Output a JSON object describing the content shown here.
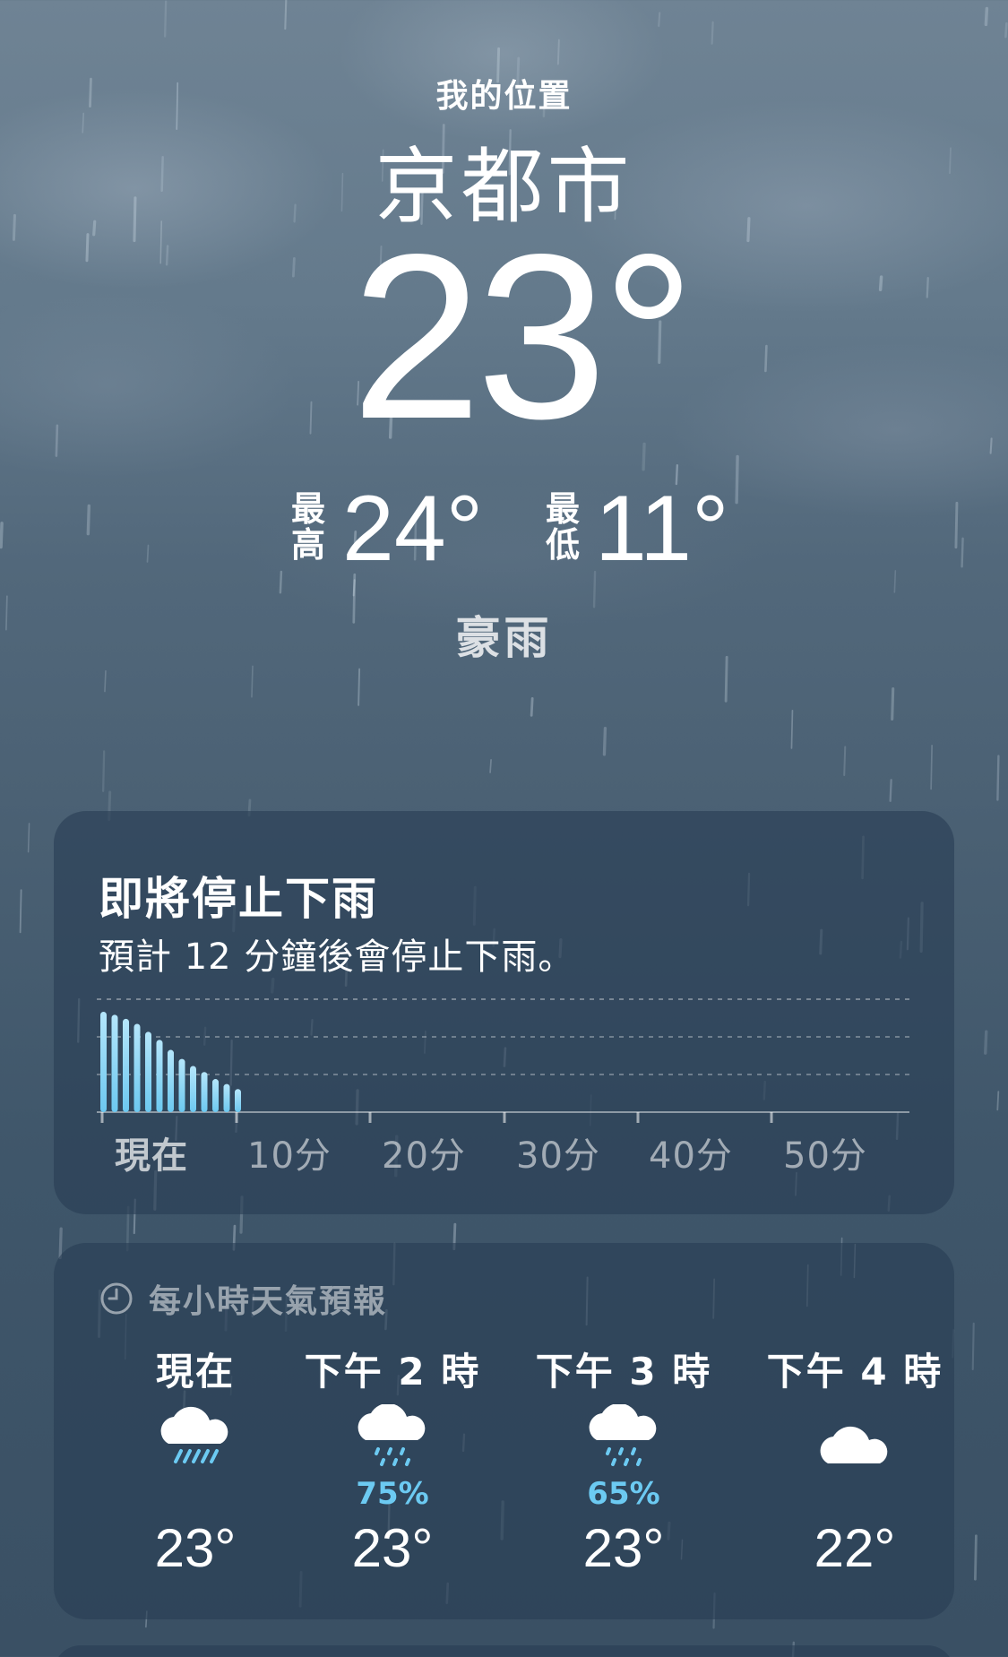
{
  "location": {
    "label": "我的位置",
    "city": "京都市",
    "temperature": "23°",
    "high_label": "最高",
    "high": "24°",
    "low_label": "最低",
    "low": "11°",
    "condition": "豪雨"
  },
  "precip_card": {
    "title": "即將停止下雨",
    "subtitle": "預計 12 分鐘後會停止下雨。",
    "ticks": [
      "現在",
      "10分",
      "20分",
      "30分",
      "40分",
      "50分"
    ],
    "intensity": [
      1.0,
      0.97,
      0.93,
      0.88,
      0.8,
      0.72,
      0.62,
      0.53,
      0.46,
      0.4,
      0.33,
      0.28,
      0.23
    ],
    "accent": "#8fd6f7"
  },
  "hourly_card": {
    "header": "每小時天氣預報",
    "header_icon": "clock-icon",
    "hours": [
      {
        "time": "現在",
        "icon": "heavy-rain-icon",
        "precip": "",
        "temp": "23°"
      },
      {
        "time": "下午 2 時",
        "icon": "drizzle-icon",
        "precip": "75%",
        "temp": "23°"
      },
      {
        "time": "下午 3 時",
        "icon": "drizzle-icon",
        "precip": "65%",
        "temp": "23°"
      },
      {
        "time": "下午 4 時",
        "icon": "cloud-icon",
        "precip": "",
        "temp": "22°"
      }
    ],
    "precip_color": "#6ccaf2"
  }
}
